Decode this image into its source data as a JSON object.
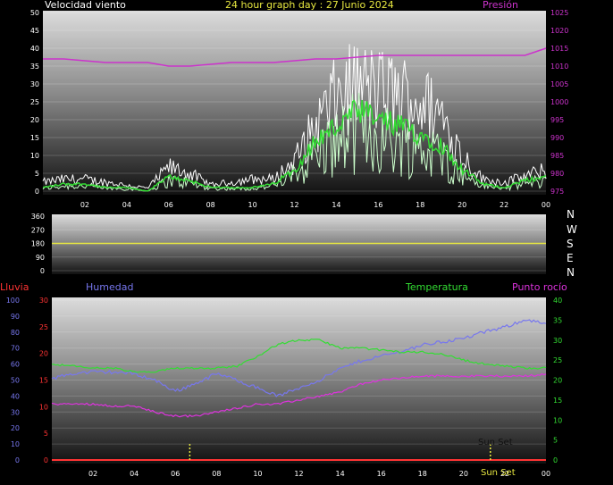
{
  "header": {
    "wind_title": "Velocidad viento",
    "graph_title": "24 hour graph day : 27 Junio 2024",
    "pressure_title": "Presión"
  },
  "compass": [
    "N",
    "W",
    "S",
    "E",
    "N"
  ],
  "legend": {
    "rain": "Lluvia",
    "humidity": "Humedad",
    "temperature": "Temperatura",
    "dew_point": "Punto rocío"
  },
  "annotations": {
    "sunset_1": "Sun Set",
    "sunset_2": "Sun Set"
  },
  "colors": {
    "wind_gust": "#ffffff",
    "wind_avg": "#33dd33",
    "wind_light": "#ccffcc",
    "pressure": "#cc33cc",
    "direction": "#e8e840",
    "humidity": "#7777ee",
    "temperature": "#33dd33",
    "dew_point": "#dd33dd",
    "rain": "#ff3333",
    "marker": "#e8e840"
  },
  "chart_data": [
    {
      "type": "line",
      "title": "Velocidad viento / Presión",
      "x_ticks": [
        "02",
        "04",
        "06",
        "08",
        "10",
        "12",
        "14",
        "16",
        "18",
        "20",
        "22",
        "00"
      ],
      "y_left_ticks": [
        "0",
        "5",
        "10",
        "15",
        "20",
        "25",
        "30",
        "35",
        "40",
        "45",
        "50"
      ],
      "y_left_range": [
        0,
        50
      ],
      "y_right_ticks": [
        "975",
        "980",
        "985",
        "990",
        "995",
        "1000",
        "1005",
        "1010",
        "1015",
        "1020",
        "1025"
      ],
      "y_right_range": [
        975,
        1025
      ],
      "x_hours": [
        0,
        1,
        2,
        3,
        4,
        5,
        6,
        7,
        8,
        9,
        10,
        11,
        12,
        13,
        14,
        15,
        16,
        17,
        18,
        19,
        20,
        21,
        22,
        23,
        24
      ],
      "series": [
        {
          "name": "Gust",
          "values": [
            3,
            4,
            4,
            3,
            2,
            1,
            8,
            6,
            2,
            3,
            4,
            4,
            10,
            22,
            32,
            36,
            34,
            33,
            30,
            26,
            12,
            4,
            3,
            5,
            7
          ]
        },
        {
          "name": "Average",
          "values": [
            1,
            2,
            2,
            1,
            1,
            0,
            4,
            3,
            1,
            1,
            1,
            2,
            6,
            14,
            18,
            22,
            20,
            18,
            16,
            13,
            6,
            2,
            1,
            3,
            4
          ]
        },
        {
          "name": "Presión",
          "values": [
            1012,
            1012,
            1011.5,
            1011,
            1011,
            1011,
            1010,
            1010,
            1010.5,
            1011,
            1011,
            1011,
            1011.5,
            1012,
            1012,
            1012.5,
            1013,
            1013,
            1013,
            1013,
            1013,
            1013,
            1013,
            1013,
            1015
          ]
        }
      ]
    },
    {
      "type": "line",
      "title": "Dirección",
      "x_ticks": [
        "02",
        "04",
        "06",
        "08",
        "10",
        "12",
        "14",
        "16",
        "18",
        "20",
        "22",
        "00"
      ],
      "y_ticks": [
        "0",
        "90",
        "180",
        "270",
        "360"
      ],
      "y_range": [
        0,
        360
      ],
      "series": [
        {
          "name": "Dirección",
          "values": [
            180,
            180
          ]
        }
      ]
    },
    {
      "type": "line",
      "title": "Lluvia / Humedad / Temperatura / Punto rocío",
      "x_ticks": [
        "02",
        "04",
        "06",
        "08",
        "10",
        "12",
        "14",
        "16",
        "18",
        "20",
        "22",
        "00"
      ],
      "y_hum_ticks": [
        "0",
        "10",
        "20",
        "30",
        "40",
        "50",
        "60",
        "70",
        "80",
        "90",
        "100"
      ],
      "y_rain_ticks": [
        "0",
        "5",
        "10",
        "15",
        "20",
        "25",
        "30"
      ],
      "y_temp_ticks": [
        "0",
        "5",
        "10",
        "15",
        "20",
        "25",
        "30",
        "35",
        "40"
      ],
      "x_hours": [
        0,
        1,
        2,
        3,
        4,
        5,
        6,
        7,
        8,
        9,
        10,
        11,
        12,
        13,
        14,
        15,
        16,
        17,
        18,
        19,
        20,
        21,
        22,
        23,
        24
      ],
      "series": [
        {
          "name": "Humedad",
          "values": [
            51,
            54,
            55,
            55,
            54,
            50,
            43,
            48,
            54,
            50,
            45,
            40,
            45,
            50,
            57,
            62,
            65,
            68,
            72,
            74,
            76,
            80,
            83,
            88,
            85
          ]
        },
        {
          "name": "Temperatura",
          "values": [
            24,
            23.5,
            23,
            23,
            22,
            22,
            23,
            23,
            23,
            23.5,
            26,
            29,
            30,
            30,
            28,
            28,
            27.5,
            27,
            27,
            26.5,
            25,
            24,
            23.5,
            23,
            23
          ]
        },
        {
          "name": "Punto rocío",
          "values": [
            14,
            14,
            14,
            13.5,
            13.5,
            12,
            11,
            11,
            12,
            13,
            14,
            14,
            15,
            16,
            17,
            19,
            20,
            20.5,
            21,
            21,
            21,
            21,
            21,
            21,
            21.5
          ]
        },
        {
          "name": "Lluvia",
          "values": [
            0,
            0
          ]
        }
      ]
    }
  ]
}
